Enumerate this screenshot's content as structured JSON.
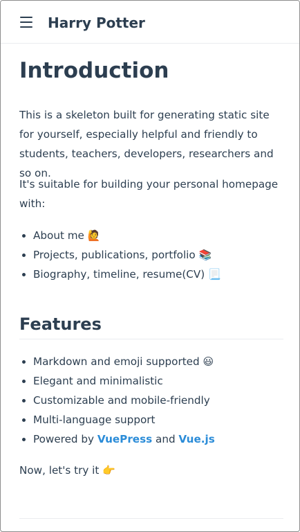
{
  "navbar": {
    "menu_icon": "hamburger-menu-icon",
    "title": "Harry Potter"
  },
  "intro": {
    "heading": "Introduction",
    "paragraph1": "This is a skeleton built for generating static site for yourself, especially helpful and friendly to students, teachers, developers, researchers and so on.",
    "paragraph2": "It's suitable for building your personal homepage with:",
    "items": [
      {
        "text": "About me",
        "emoji": "🙋"
      },
      {
        "text": "Projects, publications, portfolio",
        "emoji": "📚"
      },
      {
        "text": "Biography, timeline, resume(CV)",
        "emoji": "📃"
      }
    ]
  },
  "features": {
    "heading": "Features",
    "items": [
      {
        "text": "Markdown and emoji supported",
        "emoji": "😃"
      },
      {
        "text": "Elegant and minimalistic"
      },
      {
        "text": "Customizable and mobile-friendly"
      },
      {
        "text": "Multi-language support"
      }
    ],
    "powered": {
      "prefix": "Powered by ",
      "link1": "VuePress",
      "middle": " and ",
      "link2": "Vue.js"
    },
    "try_text": "Now, let's try it",
    "try_emoji": "👉"
  },
  "colors": {
    "text": "#2c3e50",
    "link": "#2b8cd8",
    "border": "#eaecef"
  }
}
